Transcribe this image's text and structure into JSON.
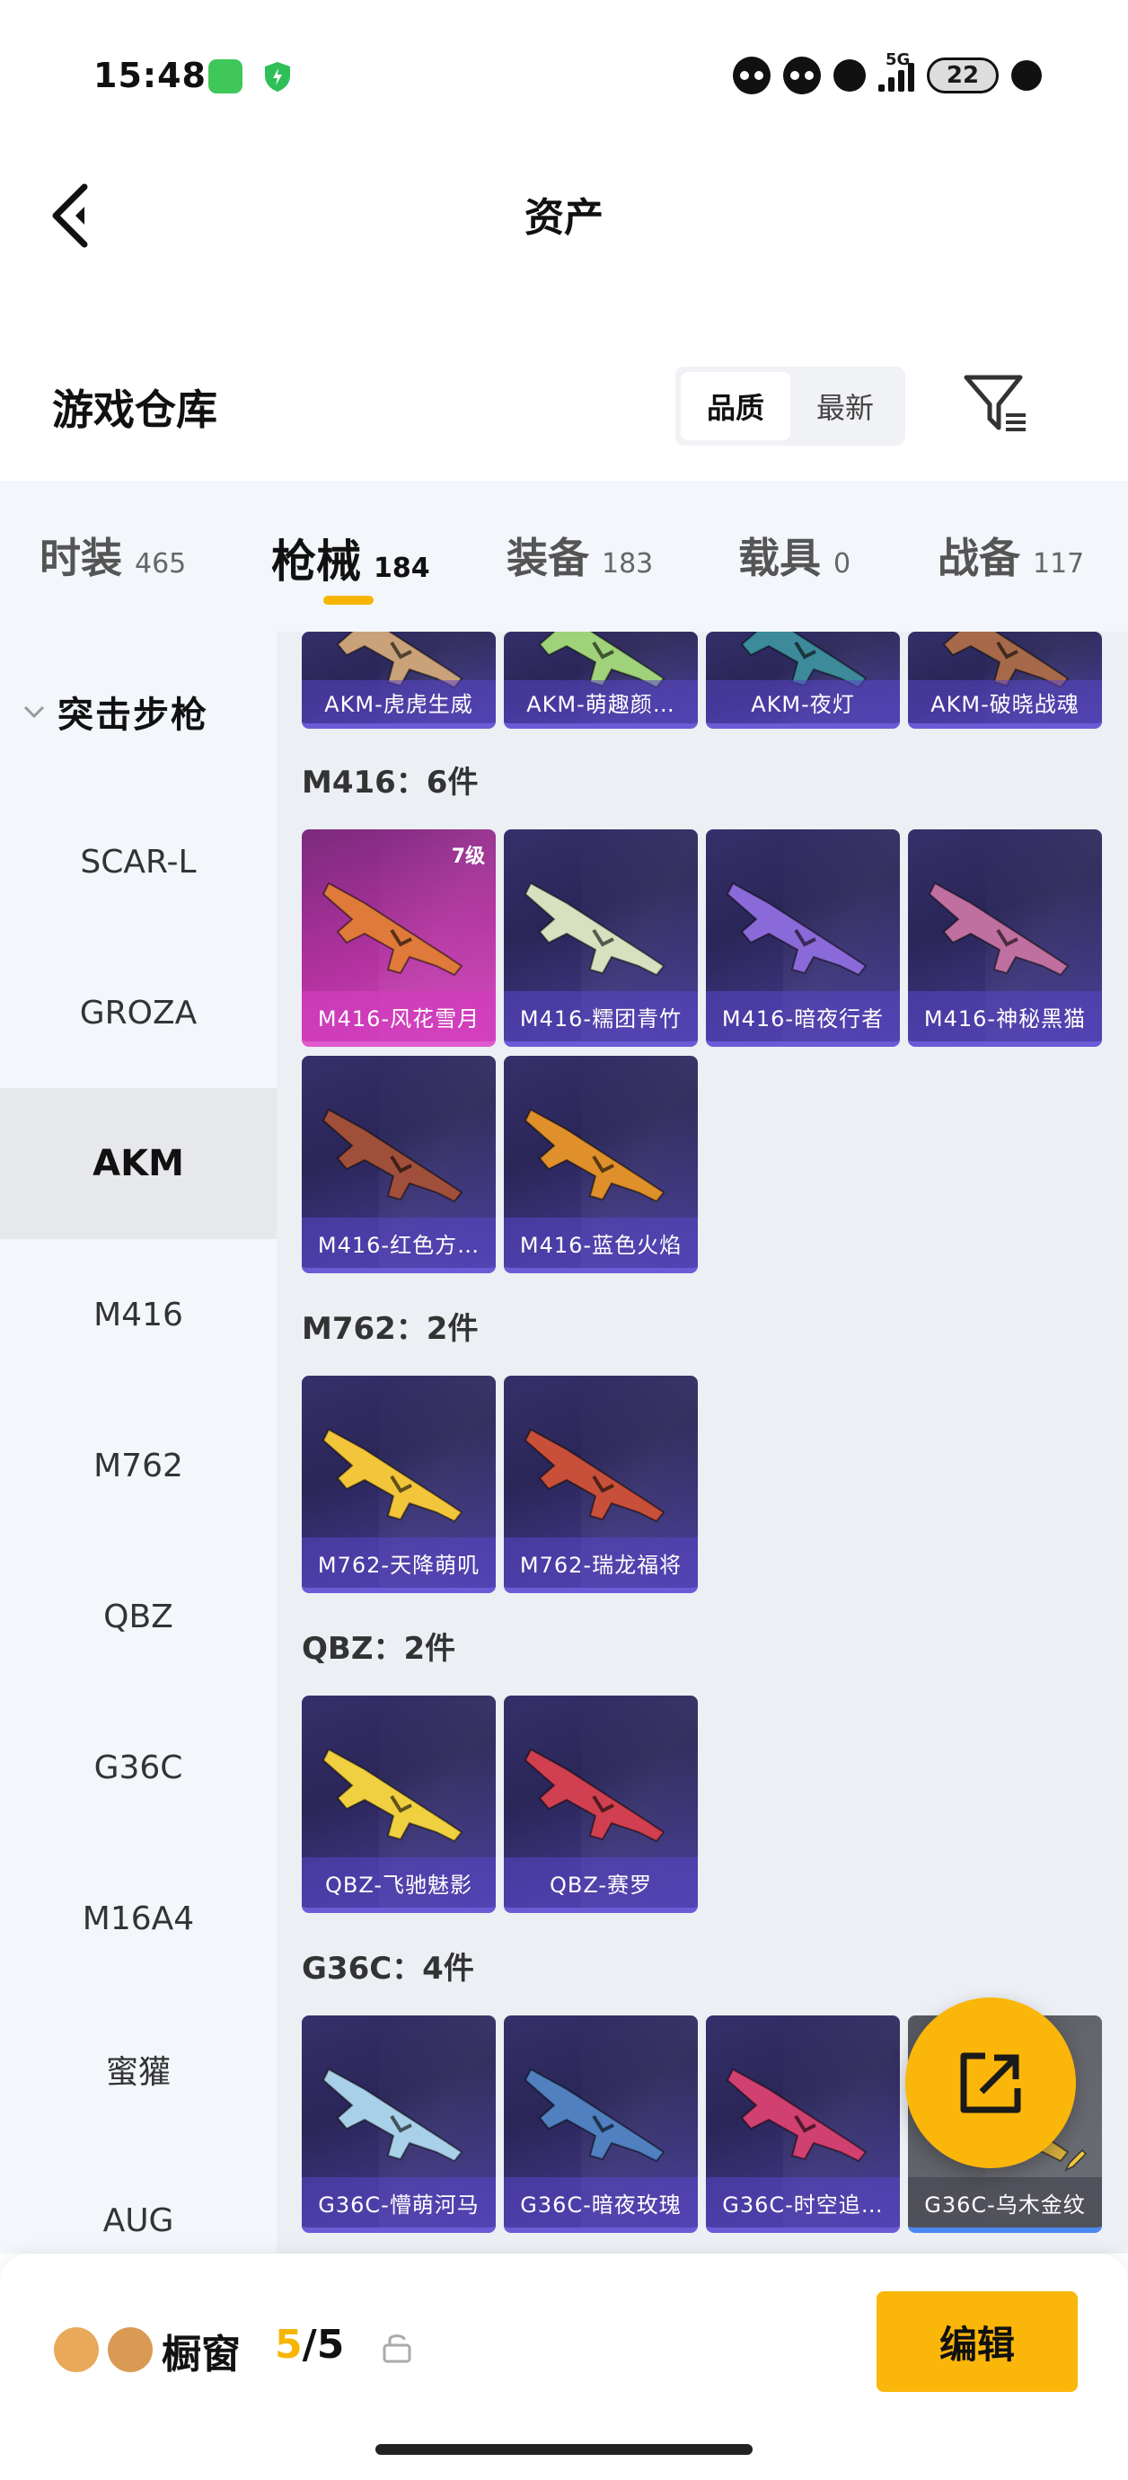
{
  "status_bar": {
    "time": "15:48",
    "network": "5G",
    "battery": "22",
    "icons": [
      "message-app-icon",
      "shield-app-icon",
      "panda-icon",
      "bear-icon",
      "paw-icon",
      "signal-icon",
      "battery-icon",
      "bird-icon"
    ]
  },
  "header": {
    "title": "资产",
    "back_icon": "chevron-left-icon"
  },
  "section": {
    "title": "游戏仓库",
    "sort": {
      "options": [
        "品质",
        "最新"
      ],
      "selected": "品质"
    },
    "filter_icon": "filter-icon"
  },
  "tabs": [
    {
      "label": "时装",
      "count": "465"
    },
    {
      "label": "枪械",
      "count": "184",
      "active": true
    },
    {
      "label": "装备",
      "count": "183"
    },
    {
      "label": "载具",
      "count": "0"
    },
    {
      "label": "战备",
      "count": "117"
    }
  ],
  "sidebar": {
    "category": "突击步枪",
    "items": [
      "SCAR-L",
      "GROZA",
      "AKM",
      "M416",
      "M762",
      "QBZ",
      "G36C",
      "M16A4",
      "蜜獾",
      "AUG"
    ],
    "active": "AKM"
  },
  "groups": [
    {
      "label": "",
      "items": [
        {
          "name": "AKM-虎虎生威"
        },
        {
          "name": "AKM-萌趣颜…"
        },
        {
          "name": "AKM-夜灯"
        },
        {
          "name": "AKM-破晓战魂"
        }
      ]
    },
    {
      "label": "M416：6件",
      "items": [
        {
          "name": "M416-风花雪月",
          "level": "7级",
          "rarity": "legendary"
        },
        {
          "name": "M416-糯团青竹"
        },
        {
          "name": "M416-暗夜行者"
        },
        {
          "name": "M416-神秘黑猫"
        },
        {
          "name": "M416-红色方…"
        },
        {
          "name": "M416-蓝色火焰"
        }
      ]
    },
    {
      "label": "M762：2件",
      "items": [
        {
          "name": "M762-天降萌叽"
        },
        {
          "name": "M762-瑞龙福将"
        }
      ]
    },
    {
      "label": "QBZ：2件",
      "items": [
        {
          "name": "QBZ-飞驰魅影"
        },
        {
          "name": "QBZ-赛罗"
        }
      ]
    },
    {
      "label": "G36C：4件",
      "items": [
        {
          "name": "G36C-懵萌河马"
        },
        {
          "name": "G36C-暗夜玫瑰"
        },
        {
          "name": "G36C-时空追…"
        },
        {
          "name": "G36C-乌木金纹"
        }
      ]
    }
  ],
  "fab_icon": "share-export-icon",
  "bottom_bar": {
    "label": "橱窗",
    "current": "5",
    "total": "/5",
    "edit_label": "编辑"
  },
  "colors": {
    "accent": "#FBB60A",
    "card_bg": "#2E2A60",
    "legendary": "#C23BB0",
    "sidebar_bg": "#F3F6FB",
    "content_bg": "#ECEFF4"
  }
}
